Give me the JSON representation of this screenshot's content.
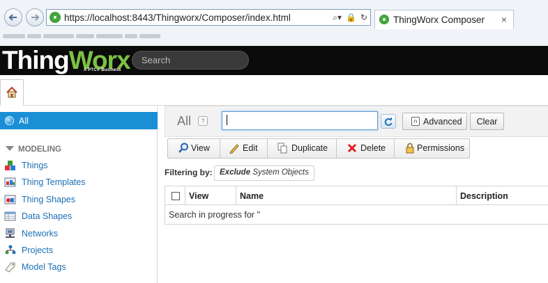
{
  "browser": {
    "url": "https://localhost:8443/Thingworx/Composer/index.html",
    "tab_title": "ThingWorx Composer",
    "tab_close": "×"
  },
  "header": {
    "logo_thing": "Thing",
    "logo_worx": "Worx",
    "logo_sub": "A PTC® Business",
    "search_placeholder": "Search"
  },
  "sidebar": {
    "all_label": "All",
    "section_label": "MODELING",
    "items": [
      {
        "label": "Things",
        "icon": "things-icon"
      },
      {
        "label": "Thing Templates",
        "icon": "thing-templates-icon"
      },
      {
        "label": "Thing Shapes",
        "icon": "thing-shapes-icon"
      },
      {
        "label": "Data Shapes",
        "icon": "data-shapes-icon"
      },
      {
        "label": "Networks",
        "icon": "networks-icon"
      },
      {
        "label": "Projects",
        "icon": "projects-icon"
      },
      {
        "label": "Model Tags",
        "icon": "model-tags-icon"
      }
    ]
  },
  "main": {
    "title": "All",
    "help": "?",
    "filter_value": "",
    "advanced_label": "Advanced",
    "clear_label": "Clear",
    "toolbar": {
      "view": "View",
      "edit": "Edit",
      "duplicate": "Duplicate",
      "delete": "Delete",
      "permissions": "Permissions"
    },
    "filtering_label": "Filtering by:",
    "filter_chip_bold": "Exclude",
    "filter_chip_rest": "System Objects",
    "columns": [
      "View",
      "Name",
      "Description"
    ],
    "message": "Search in progress for ''"
  },
  "colors": {
    "accent": "#1a8fd6",
    "brand_green": "#7cc242",
    "header_bg": "#0b0b0b"
  }
}
